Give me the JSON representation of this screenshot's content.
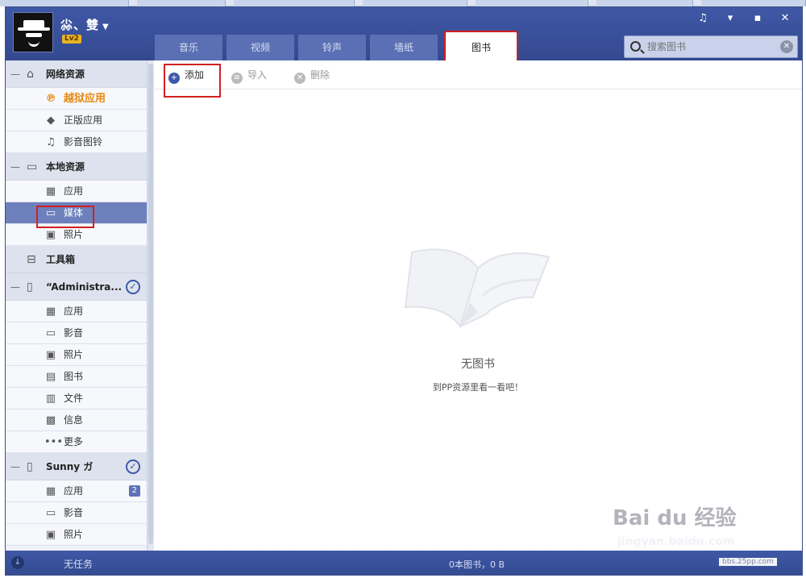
{
  "user": {
    "name": "尛、雙",
    "level": "Lv2"
  },
  "window_controls": [
    "♫",
    "▾",
    "▪",
    "✕"
  ],
  "tabs": [
    {
      "label": "音乐"
    },
    {
      "label": "视频"
    },
    {
      "label": "铃声"
    },
    {
      "label": "墙纸"
    },
    {
      "label": "图书",
      "active": true
    }
  ],
  "search": {
    "placeholder": "搜索图书"
  },
  "sidebar": {
    "online": {
      "label": "网络资源",
      "items": [
        {
          "label": "越狱应用",
          "icon": "p-icon",
          "glyph": "℗"
        },
        {
          "label": "正版应用",
          "icon": "apple-icon",
          "glyph": ""
        },
        {
          "label": "影音图铃",
          "icon": "music-icon",
          "glyph": "♫"
        }
      ]
    },
    "local": {
      "label": "本地资源",
      "items": [
        {
          "label": "应用",
          "icon": "grid-icon",
          "glyph": "▦"
        },
        {
          "label": "媒体",
          "icon": "video-icon",
          "glyph": "▭"
        },
        {
          "label": "照片",
          "icon": "photo-icon",
          "glyph": "▣"
        }
      ]
    },
    "toolbox": {
      "label": "工具箱"
    },
    "device1": {
      "label": "“Administra...",
      "items": [
        {
          "label": "应用",
          "icon": "grid-icon",
          "glyph": "▦"
        },
        {
          "label": "影音",
          "icon": "video-icon",
          "glyph": "▭"
        },
        {
          "label": "照片",
          "icon": "photo-icon",
          "glyph": "▣"
        },
        {
          "label": "图书",
          "icon": "book-icon",
          "glyph": "▤"
        },
        {
          "label": "文件",
          "icon": "file-icon",
          "glyph": "▥"
        },
        {
          "label": "信息",
          "icon": "message-icon",
          "glyph": "▩"
        },
        {
          "label": "更多",
          "icon": "more-icon",
          "glyph": "•••"
        }
      ]
    },
    "device2": {
      "label": "Sunny ガ",
      "items": [
        {
          "label": "应用",
          "icon": "grid-icon",
          "glyph": "▦",
          "badge": "2"
        },
        {
          "label": "影音",
          "icon": "video-icon",
          "glyph": "▭"
        },
        {
          "label": "照片",
          "icon": "photo-icon",
          "glyph": "▣"
        }
      ]
    }
  },
  "toolbar": {
    "add": "添加",
    "import": "导入",
    "delete": "删除"
  },
  "empty_state": {
    "title": "无图书",
    "subtitle": "到PP资源里看一看吧！"
  },
  "status": {
    "task": "无任务",
    "count": "0本图书，0 B"
  },
  "watermark": {
    "brand": "Bai du 经验",
    "url": "jingyan.baidu.com",
    "site": "bbs.25pp.com"
  },
  "colors": {
    "header": "#3f58a6",
    "highlight": "#e98a12",
    "active_item": "#6d80bc",
    "annotation_red": "#d21f1f"
  }
}
